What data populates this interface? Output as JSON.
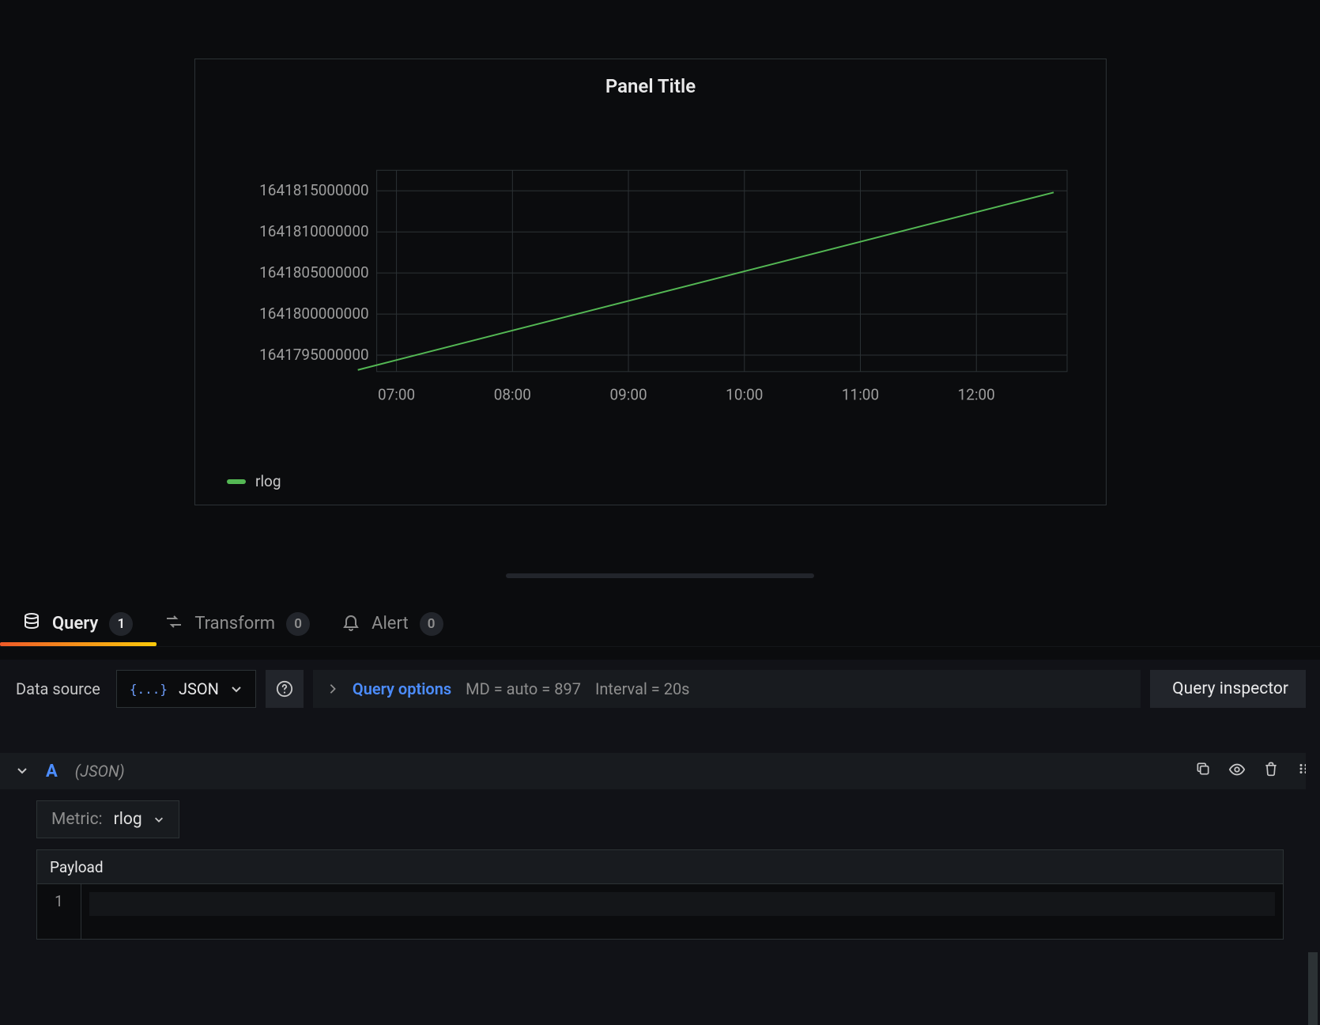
{
  "panel": {
    "title": "Panel Title",
    "legend_label": "rlog",
    "series_color": "#54b854"
  },
  "chart_data": {
    "type": "line",
    "xlabel": "",
    "ylabel": "",
    "x_ticks": [
      "07:00",
      "08:00",
      "09:00",
      "10:00",
      "11:00",
      "12:00"
    ],
    "y_ticks": [
      1641795000000,
      1641800000000,
      1641805000000,
      1641810000000,
      1641815000000
    ],
    "ylim": [
      1641793000000,
      1641817500000
    ],
    "series": [
      {
        "name": "rlog",
        "color": "#54b854",
        "points": [
          {
            "x": "06:40",
            "y": 1641793200000
          },
          {
            "x": "12:40",
            "y": 1641814800000
          }
        ]
      }
    ]
  },
  "tabs": {
    "items": [
      {
        "id": "query",
        "label": "Query",
        "count": 1,
        "icon": "database",
        "active": true
      },
      {
        "id": "transform",
        "label": "Transform",
        "count": 0,
        "icon": "transform",
        "active": false
      },
      {
        "id": "alert",
        "label": "Alert",
        "count": 0,
        "icon": "bell",
        "active": false
      }
    ]
  },
  "toolbar": {
    "datasource_label": "Data source",
    "datasource_value": "JSON",
    "query_options_label": "Query options",
    "md_text": "MD = auto = 897",
    "interval_text": "Interval = 20s",
    "inspector_label": "Query inspector"
  },
  "query_row": {
    "refid": "A",
    "datasource_name": "(JSON)",
    "metric_prefix": "Metric:",
    "metric_value": "rlog",
    "payload_label": "Payload",
    "editor_lines": [
      "1"
    ]
  }
}
